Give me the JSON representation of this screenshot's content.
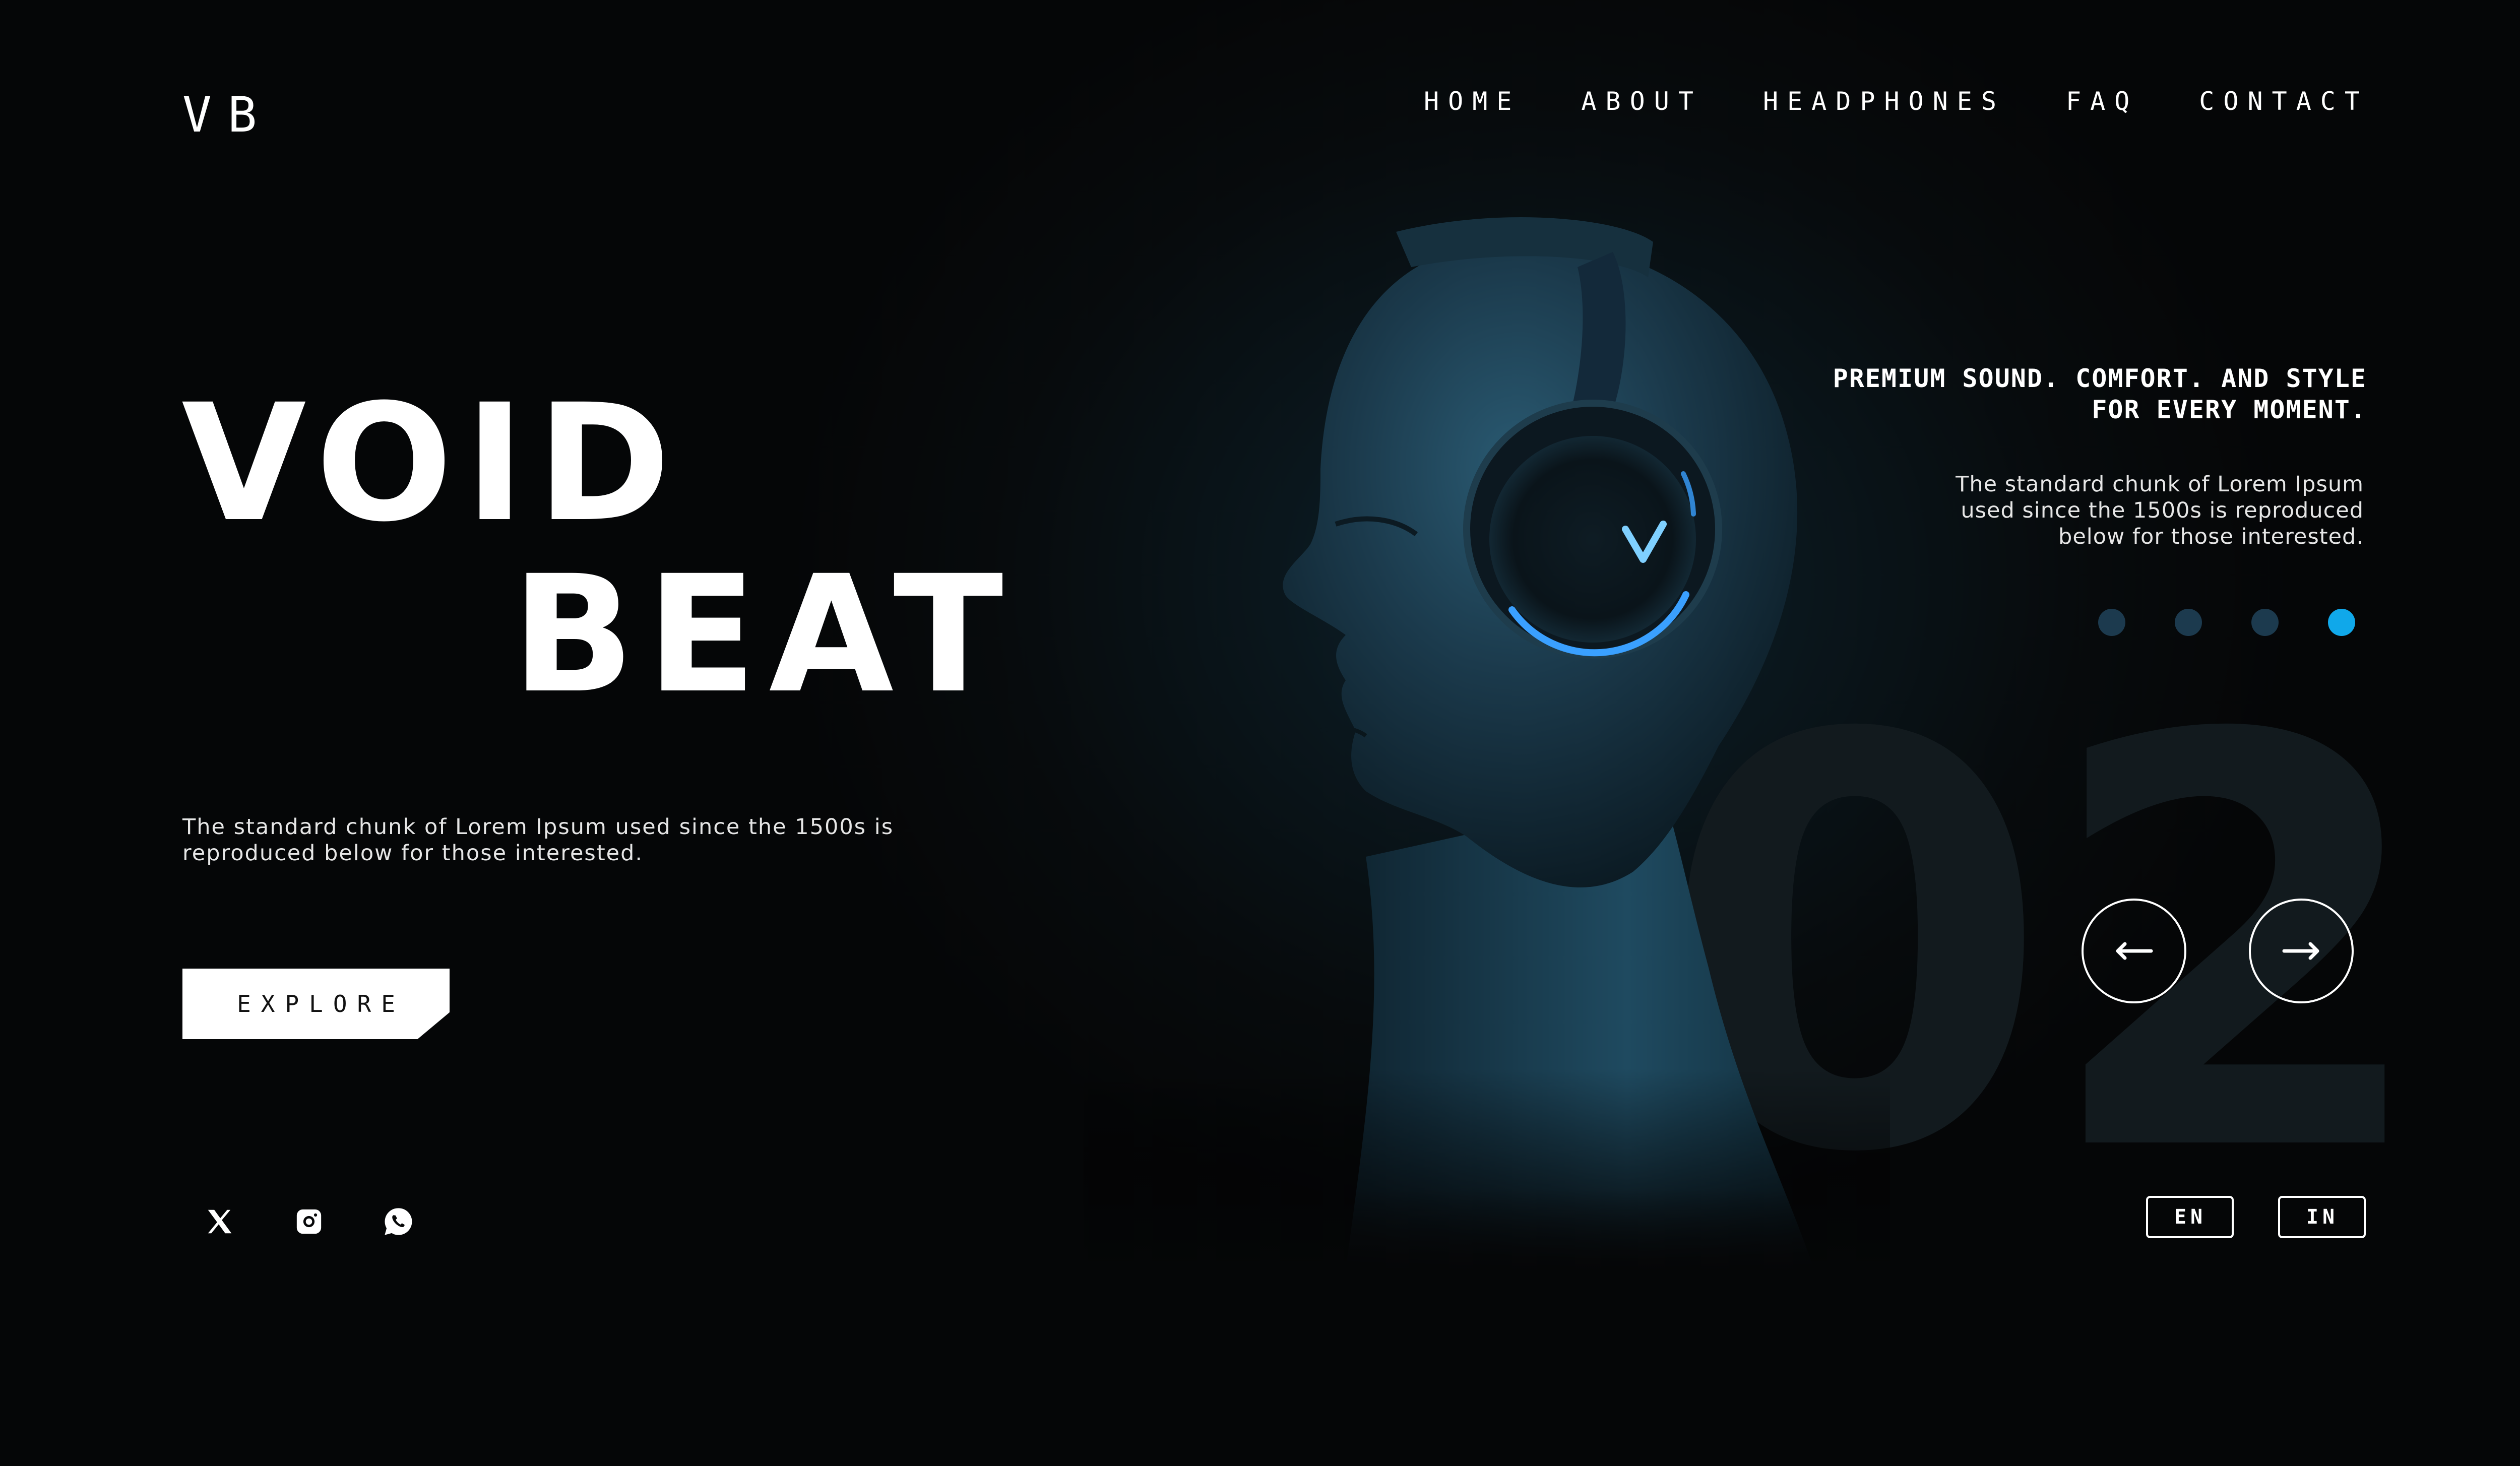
{
  "brand": {
    "logo": "VB"
  },
  "nav": {
    "items": [
      {
        "label": "HOME"
      },
      {
        "label": "ABOUT"
      },
      {
        "label": "HEADPHONES"
      },
      {
        "label": "FAQ"
      },
      {
        "label": "CONTACT"
      }
    ]
  },
  "hero": {
    "title_line1": "VOID",
    "title_line2": "BEAT",
    "description": "The standard chunk of Lorem Ipsum used since the 1500s is reproduced below for those interested.",
    "cta_label": "EXPLORE"
  },
  "side": {
    "tagline": "PREMIUM SOUND. COMFORT. AND STYLE FOR EVERY MOMENT.",
    "description": "The standard chunk of Lorem Ipsum used since the 1500s is reproduced below for those interested."
  },
  "slider": {
    "slide_number": "02",
    "dot_count": 4,
    "active_dot": 4,
    "prev_icon": "arrow-left-icon",
    "next_icon": "arrow-right-icon"
  },
  "social": {
    "items": [
      {
        "icon": "x-twitter-icon"
      },
      {
        "icon": "instagram-icon"
      },
      {
        "icon": "whatsapp-icon"
      }
    ]
  },
  "language": {
    "options": [
      "EN",
      "IN"
    ]
  },
  "colors": {
    "background": "#060708",
    "accent": "#10a8ea",
    "dot_inactive": "#1c3a4e",
    "figure_blue": "#1b3a4c",
    "headphone_glow": "#3aa0ff"
  }
}
